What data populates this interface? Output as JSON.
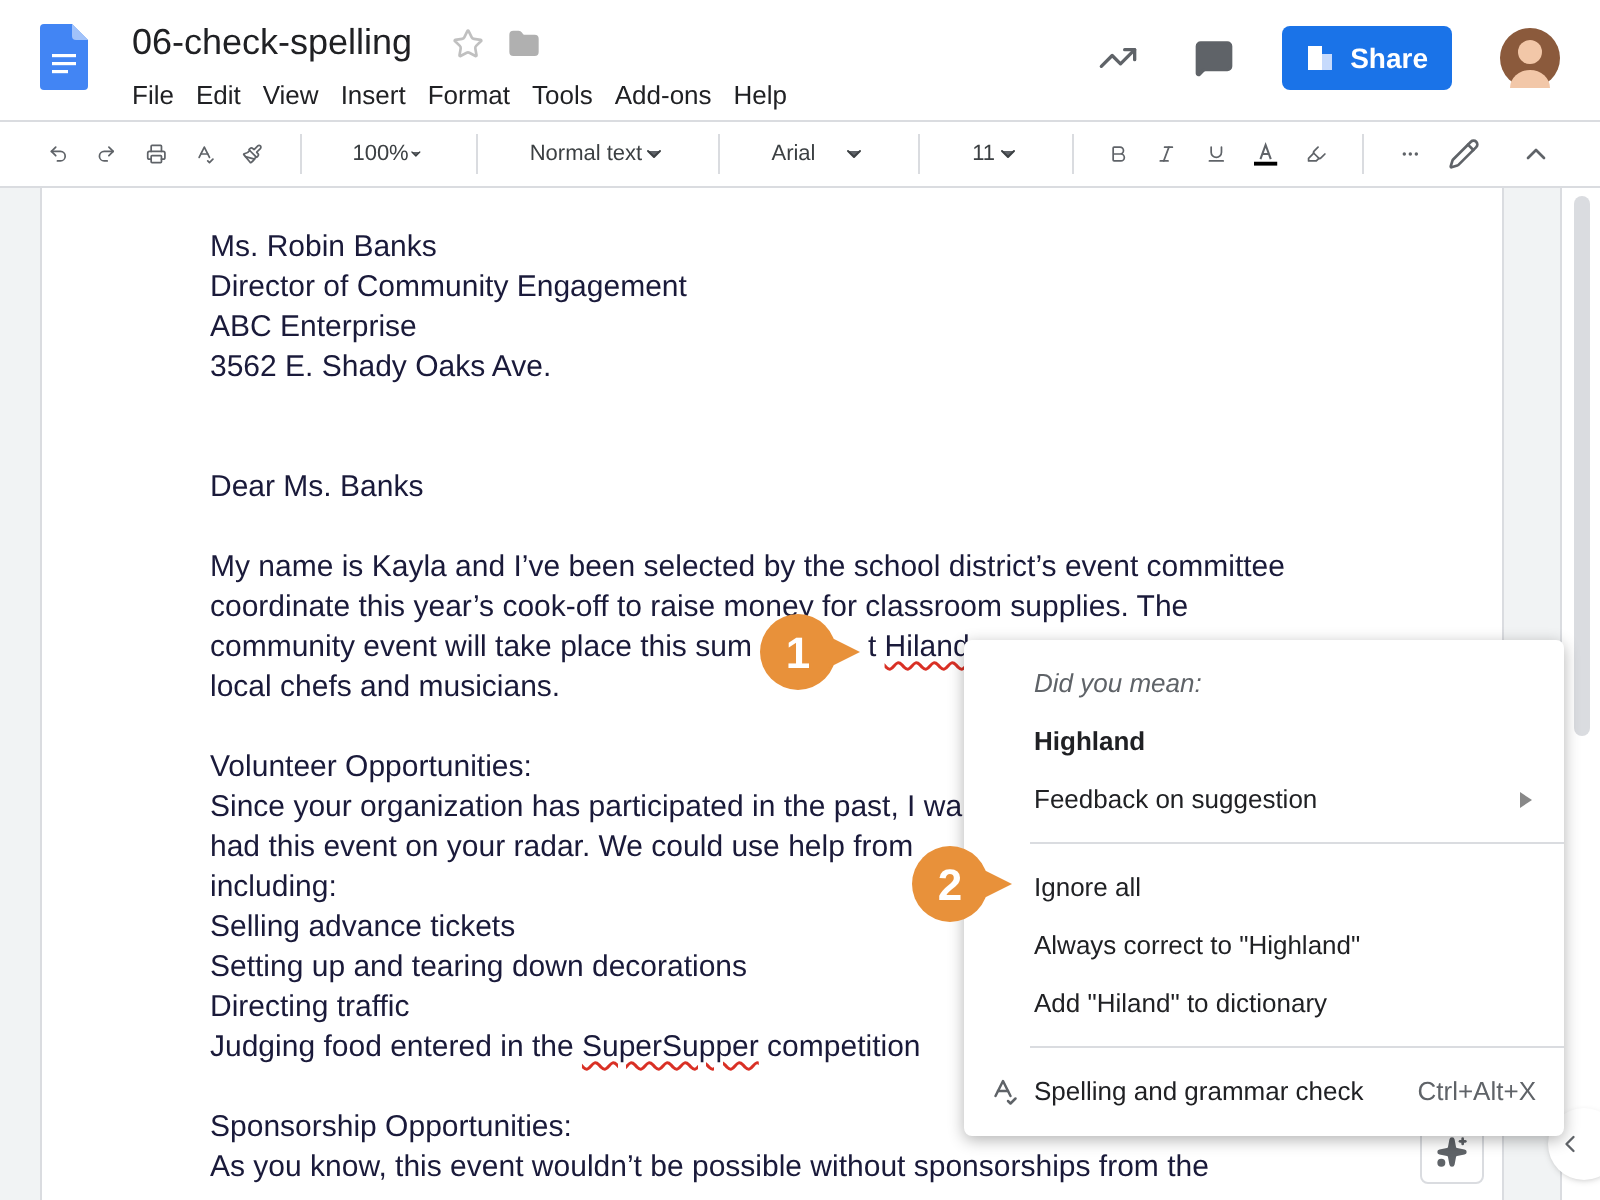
{
  "header": {
    "title": "06-check-spelling",
    "menu": [
      "File",
      "Edit",
      "View",
      "Insert",
      "Format",
      "Tools",
      "Add-ons",
      "Help"
    ],
    "share": "Share"
  },
  "toolbar": {
    "zoom": "100%",
    "style": "Normal text",
    "font": "Arial",
    "size": "11"
  },
  "document": {
    "blocks": [
      [
        [
          {
            "text": "Ms. Robin Banks"
          }
        ],
        [
          {
            "text": "Director of Community Engagement"
          }
        ],
        [
          {
            "text": "ABC Enterprise"
          }
        ],
        [
          {
            "text": "3562 E. Shady Oaks Ave."
          }
        ]
      ],
      [
        [
          {
            "text": "Dear Ms. Banks"
          }
        ]
      ],
      [
        [
          {
            "text": "My name is Kayla and I’ve been selected by the school district’s event committee"
          }
        ],
        [
          {
            "text": "coordinate this year’s cook-off to raise money for classroom supplies. The"
          }
        ],
        [
          {
            "text": "community event will take place this sum"
          },
          {
            "text": "t ",
            "gap": true
          },
          {
            "text": "Hiland",
            "misspelled": true
          }
        ],
        [
          {
            "text": "local chefs and musicians."
          }
        ]
      ],
      [
        [
          {
            "text": "Volunteer Opportunities:"
          }
        ],
        [
          {
            "text": "Since your organization has participated in the past, I wa"
          }
        ],
        [
          {
            "text": "had this event on your radar. We could use help from"
          }
        ],
        [
          {
            "text": "including:"
          }
        ],
        [
          {
            "text": "Selling advance tickets"
          }
        ],
        [
          {
            "text": "Setting up and tearing down decorations"
          }
        ],
        [
          {
            "text": "Directing traffic"
          }
        ],
        [
          {
            "text": "Judging food entered in the "
          },
          {
            "text": "SuperSupper",
            "misspelled": true
          },
          {
            "text": " competition"
          }
        ]
      ],
      [
        [
          {
            "text": "Sponsorship Opportunities:"
          }
        ],
        [
          {
            "text": "As you know, this event wouldn’t be possible without sponsorships from the"
          }
        ]
      ]
    ]
  },
  "context_menu": {
    "heading": "Did you mean:",
    "suggestion": "Highland",
    "feedback": "Feedback on suggestion",
    "actions": [
      "Ignore all",
      "Always correct to \"Highland\"",
      "Add \"Hiland\" to dictionary"
    ],
    "check": "Spelling and grammar check",
    "shortcut": "Ctrl+Alt+X"
  },
  "callouts": [
    "1",
    "2"
  ]
}
